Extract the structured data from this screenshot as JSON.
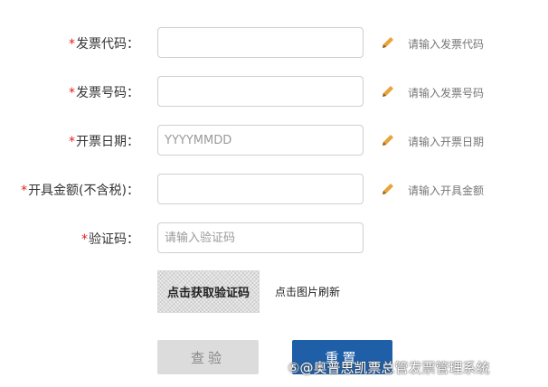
{
  "form": {
    "required_mark": "*",
    "fields": [
      {
        "label": "发票代码：",
        "value": "",
        "placeholder": "",
        "hint": "请输入发票代码"
      },
      {
        "label": "发票号码：",
        "value": "",
        "placeholder": "",
        "hint": "请输入发票号码"
      },
      {
        "label": "开票日期：",
        "value": "",
        "placeholder": "YYYYMMDD",
        "hint": "请输入开票日期"
      },
      {
        "label": "开具金额(不含税)：",
        "value": "",
        "placeholder": "",
        "hint": "请输入开具金额"
      },
      {
        "label": "验证码：",
        "value": "",
        "placeholder": "请输入验证码",
        "hint": ""
      }
    ],
    "captcha": {
      "image_text": "点击获取验证码",
      "refresh_label": "点击图片刷新"
    },
    "buttons": {
      "check_label": "查验",
      "reset_label": "重置"
    }
  },
  "watermark": "⑤@奥普思凯票总管发票管理系统",
  "colors": {
    "required": "#e02020",
    "pencil": "#e8a33a",
    "primary": "#1e5fa8",
    "disabled": "#dcdcdc"
  },
  "icons": {
    "edit": "pencil-icon"
  }
}
